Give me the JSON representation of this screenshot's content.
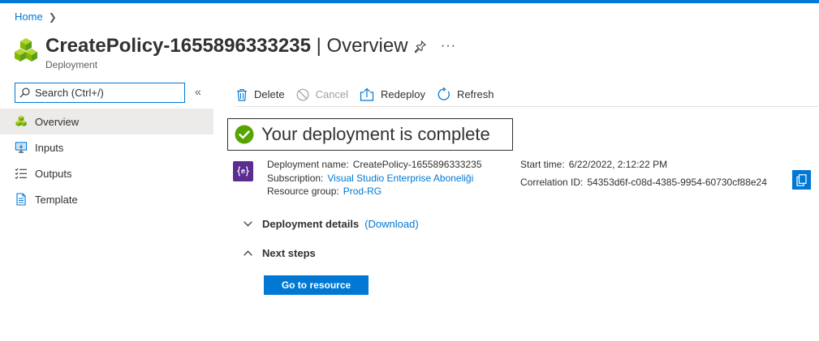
{
  "breadcrumb": {
    "home": "Home"
  },
  "header": {
    "title_name": "CreatePolicy-1655896333235",
    "title_sep": " | ",
    "title_section": "Overview",
    "subtitle": "Deployment",
    "pin_icon": "pin-icon",
    "more_label": "···"
  },
  "sidebar": {
    "search_placeholder": "Search (Ctrl+/)",
    "collapse_label": "«",
    "items": [
      {
        "label": "Overview",
        "icon": "cubes-icon",
        "active": true
      },
      {
        "label": "Inputs",
        "icon": "monitor-icon",
        "active": false
      },
      {
        "label": "Outputs",
        "icon": "list-icon",
        "active": false
      },
      {
        "label": "Template",
        "icon": "document-icon",
        "active": false
      }
    ]
  },
  "toolbar": {
    "delete": "Delete",
    "cancel": "Cancel",
    "redeploy": "Redeploy",
    "refresh": "Refresh"
  },
  "status": {
    "message": "Your deployment is complete"
  },
  "deployment": {
    "name_label": "Deployment name:",
    "name_value": "CreatePolicy-1655896333235",
    "subscription_label": "Subscription:",
    "subscription_value": "Visual Studio Enterprise Aboneliği",
    "resource_group_label": "Resource group:",
    "resource_group_value": "Prod-RG",
    "start_time_label": "Start time:",
    "start_time_value": "6/22/2022, 2:12:22 PM",
    "correlation_label": "Correlation ID:",
    "correlation_value": "54353d6f-c08d-4385-9954-60730cf88e24"
  },
  "sections": {
    "details_label": "Deployment details",
    "details_link": "(Download)",
    "next_steps_label": "Next steps",
    "go_button": "Go to resource"
  },
  "colors": {
    "accent": "#0078d4",
    "success": "#57a300",
    "deployment_icon": "#5c2d91",
    "nav_active_bg": "#edebe9"
  }
}
